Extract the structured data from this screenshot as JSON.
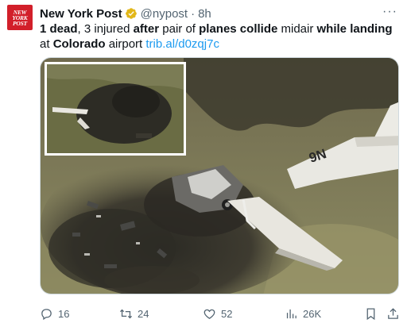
{
  "colors": {
    "brand_red": "#d21f2a",
    "link_blue": "#1d9bf0",
    "verified_gold": "#e2b719",
    "muted": "#536471"
  },
  "account": {
    "avatar_icon": "new-york-post-logo",
    "avatar_text": "NEW YORK POST",
    "display_name": "New York Post",
    "verified_icon": "verified-badge-icon",
    "handle": "@nypost",
    "separator": "·",
    "time": "8h"
  },
  "more_label": "···",
  "tweet": {
    "segments": [
      {
        "text": "1 dead",
        "bold": true
      },
      {
        "text": ", 3 injured ",
        "bold": false
      },
      {
        "text": "after",
        "bold": true
      },
      {
        "text": " pair of ",
        "bold": false
      },
      {
        "text": "planes collide",
        "bold": true
      },
      {
        "text": " midair ",
        "bold": false
      },
      {
        "text": "while landing",
        "bold": true
      },
      {
        "text": " at ",
        "bold": false
      },
      {
        "text": "Colorado",
        "bold": true
      },
      {
        "text": " airport ",
        "bold": false
      }
    ],
    "link": "trib.al/d0zqj7c"
  },
  "media": {
    "description_icon": "aerial-crash-photo",
    "plane_registration": "9N"
  },
  "actions": {
    "replies": "16",
    "reposts": "24",
    "likes": "52",
    "views": "26K"
  }
}
